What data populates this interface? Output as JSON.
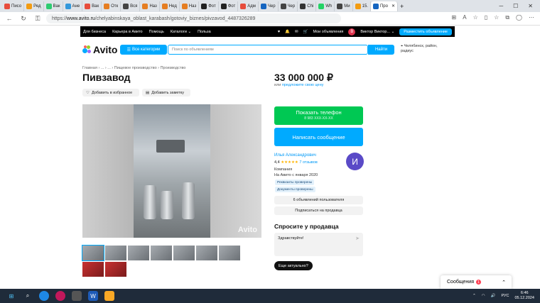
{
  "browser": {
    "tabs": [
      "Писо",
      "Ред",
      "Вак",
      "Ане",
      "Вак",
      "Отк",
      "Вся",
      "Наз",
      "Нед",
      "Наз",
      "Фот",
      "Фот",
      "Адм",
      "Чер",
      "Чер",
      "Chi",
      "Wh",
      "Ми",
      "15.",
      "Про"
    ],
    "url_prefix": "https://",
    "url_host": "www.avito.ru",
    "url_path": "/chelyabinskaya_oblast_karabash/gotoviy_biznes/pivzavod_4487326289"
  },
  "avito_topbar": {
    "links": [
      "Для бизнеса",
      "Карьера в Авито",
      "Помощь",
      "Каталоги ⌄",
      "Польза"
    ],
    "my_ads": "Мои объявления",
    "user_initial": "В",
    "user_name": "Виктор Виктор... ⌄",
    "post_button": "Разместить объявление"
  },
  "header": {
    "logo_text": "Avito",
    "categories_button": "Все категории",
    "search_placeholder": "Поиск по объявлениям",
    "find_button": "Найти",
    "location": "Челябинск, район, радиус"
  },
  "listing": {
    "breadcrumb": "Главная › ... › ... › Пищевое производство › Производство",
    "title": "Пивзавод",
    "favorite_button": "Добавить в избранное",
    "note_button": "Добавить заметку",
    "photo_watermark": "Avito",
    "thumbnail_count": 9,
    "price": "33 000 000 ₽",
    "price_sub_prefix": "или ",
    "price_sub_link": "предложите свою цену"
  },
  "contact": {
    "phone_button": "Показать телефон",
    "phone_masked": "8 983 XXX-XX-XX",
    "message_button": "Написать сообщение"
  },
  "seller": {
    "name": "Илья Александрович",
    "rating": "4,4",
    "stars": "★★★★★",
    "reviews": "7 отзывов",
    "type": "Компания",
    "since": "На Авито с января 2020",
    "badge_requisites": "Реквизиты проверены",
    "badge_documents": "Документы проверены",
    "avatar_letter": "И",
    "ads_button": "6 объявлений пользователя",
    "subscribe_button": "Подписаться на продавца"
  },
  "ask": {
    "title": "Спросите у продавца",
    "message": "Здравствуйте!",
    "quick_question": "Еще актуально?"
  },
  "chat": {
    "label": "Сообщения",
    "count": "1"
  },
  "taskbar": {
    "lang": "РУС",
    "time": "6:46",
    "date": "05.12.2024"
  },
  "colors": {
    "accent": "#00aaff",
    "phone_green": "#00c853",
    "avatar_purple": "#5a4ac7"
  }
}
